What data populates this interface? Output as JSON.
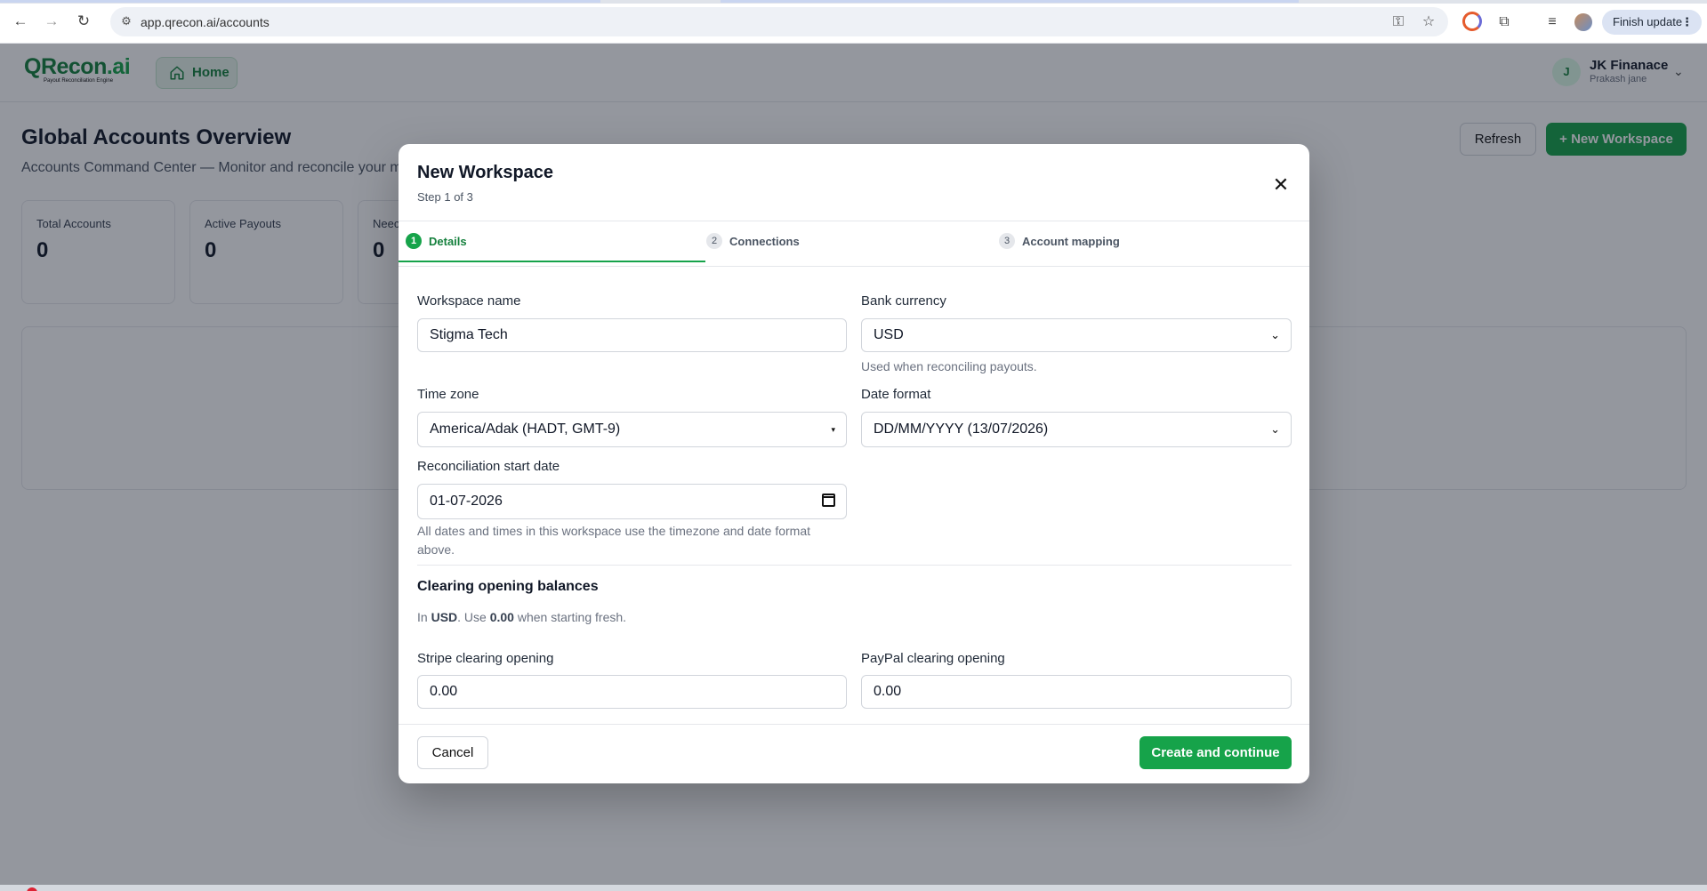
{
  "browser": {
    "url": "app.qrecon.ai/accounts",
    "finish_update_label": "Finish update",
    "icons": [
      "back-icon",
      "forward-icon",
      "reload-icon",
      "site-info-icon",
      "password-key-icon",
      "bookmark-star-icon",
      "extension-c-icon",
      "extensions-puzzle-icon",
      "media-queue-icon",
      "profile-icon",
      "menu-dots-icon"
    ]
  },
  "app": {
    "logo_text": "QRecon",
    "logo_suffix": ".ai",
    "logo_tagline": "Payout Reconciliation Engine",
    "home_label": "Home",
    "user": {
      "avatar_initial": "J",
      "name": "JK Finanace",
      "subtitle": "Prakash jane"
    },
    "page_title": "Global Accounts Overview",
    "page_subtitle": "Accounts Command Center — Monitor and reconcile your m",
    "refresh_label": "Refresh",
    "new_workspace_label": "+ New Workspace",
    "stats": [
      {
        "label": "Total Accounts",
        "value": "0"
      },
      {
        "label": "Active Payouts",
        "value": "0"
      },
      {
        "label": "Neec",
        "value": "0"
      }
    ]
  },
  "modal": {
    "title": "New Workspace",
    "step_text": "Step 1 of 3",
    "close_symbol": "✕",
    "steps": [
      {
        "num": "1",
        "label": "Details",
        "active": true
      },
      {
        "num": "2",
        "label": "Connections",
        "active": false
      },
      {
        "num": "3",
        "label": "Account mapping",
        "active": false
      }
    ],
    "fields": {
      "workspace_name": {
        "label": "Workspace name",
        "value": "Stigma Tech"
      },
      "bank_currency": {
        "label": "Bank currency",
        "value": "USD",
        "hint": "Used when reconciling payouts."
      },
      "time_zone": {
        "label": "Time zone",
        "value": "America/Adak (HADT, GMT-9)"
      },
      "date_format": {
        "label": "Date format",
        "value": "DD/MM/YYYY (13/07/2026)"
      },
      "start_date": {
        "label": "Reconciliation start date",
        "value": "01-07-2026"
      },
      "dates_hint": "All dates and times in this workspace use the timezone and date format above."
    },
    "clearing": {
      "title": "Clearing opening balances",
      "hint_prefix": "In ",
      "hint_currency": "USD",
      "hint_mid": ". Use ",
      "hint_zero": "0.00",
      "hint_suffix": " when starting fresh.",
      "stripe": {
        "label": "Stripe clearing opening",
        "value": "0.00"
      },
      "paypal": {
        "label": "PayPal clearing opening",
        "value": "0.00"
      }
    },
    "cancel_label": "Cancel",
    "create_label": "Create and continue"
  },
  "colors": {
    "brand_green": "#16a34a",
    "dark_green": "#15803d",
    "overlay": "rgba(17,24,39,0.45)"
  }
}
